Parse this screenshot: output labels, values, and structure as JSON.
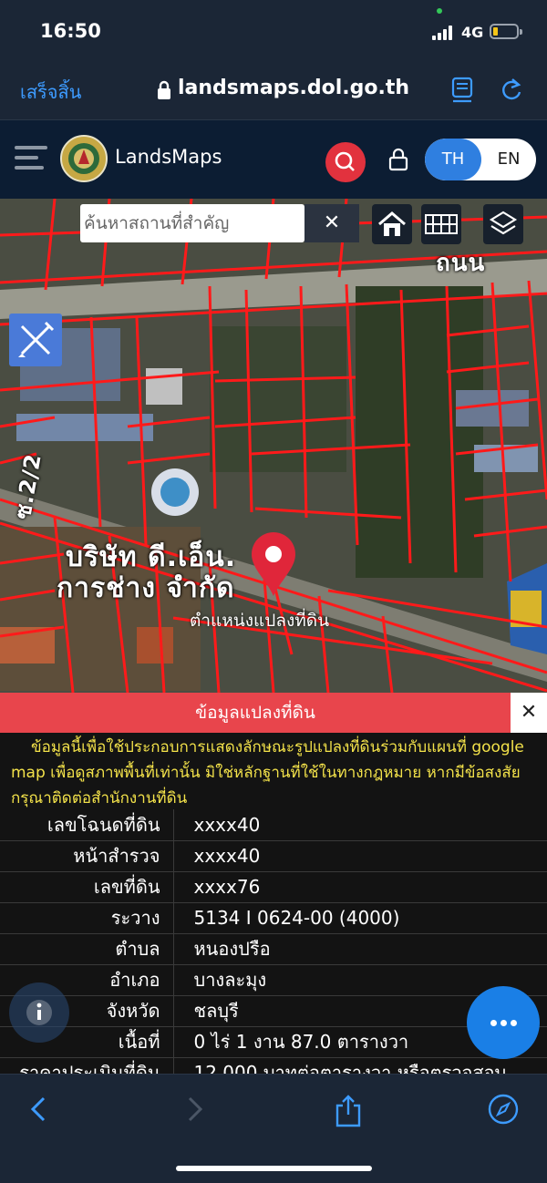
{
  "status": {
    "time": "16:50",
    "network": "4G"
  },
  "browser": {
    "done_label": "เสร็จสิ้น",
    "url": "landsmaps.dol.go.th",
    "icons": [
      "lock-icon",
      "reader-icon",
      "reload-icon"
    ]
  },
  "app": {
    "brand": "LandsMaps",
    "lang_th": "TH",
    "lang_en": "EN",
    "accent": "#e2323e",
    "toggle_color": "#2f7fe0"
  },
  "map": {
    "search_placeholder": "ค้นหาสถานที่สำคัญ",
    "clear_label": "✕",
    "road_label": "ถนน",
    "company_line1": "บริษัท ดี.เอ็น.",
    "company_line2": "การช่าง จำกัด",
    "soi_label": "ซ.2/2",
    "parcel_label": "ตำแหน่งแปลงที่ดิน",
    "parcel_line_color": "#ff1a1a"
  },
  "panel": {
    "title": "ข้อมูลแปลงที่ดิน",
    "close_label": "✕",
    "disclaimer": "ข้อมูลนี้เพื่อใช้ประกอบการแสดงลักษณะรูปแปลงที่ดินร่วมกับแผนที่ google map เพื่อดูสภาพพื้นที่เท่านั้น มิใช่หลักฐานที่ใช้ในทางกฎหมาย หากมีข้อสงสัย กรุณาติดต่อสำนักงานที่ดิน",
    "rows": [
      {
        "key": "เลขโฉนดที่ดิน",
        "value": "xxxx40"
      },
      {
        "key": "หน้าสำรวจ",
        "value": "xxxx40"
      },
      {
        "key": "เลขที่ดิน",
        "value": "xxxx76"
      },
      {
        "key": "ระวาง",
        "value": "5134 I 0624-00 (4000)"
      },
      {
        "key": "ตำบล",
        "value": "หนองปรือ"
      },
      {
        "key": "อำเภอ",
        "value": "บางละมุง"
      },
      {
        "key": "จังหวัด",
        "value": "ชลบุรี"
      },
      {
        "key": "เนื้อที่",
        "value": "0 ไร่ 1 งาน 87.0 ตารางวา"
      },
      {
        "key": "ราคาประเมินที่ดิน",
        "value": "12,000 บาทต่อตารางวา หรือตรวจสอบ"
      }
    ]
  }
}
